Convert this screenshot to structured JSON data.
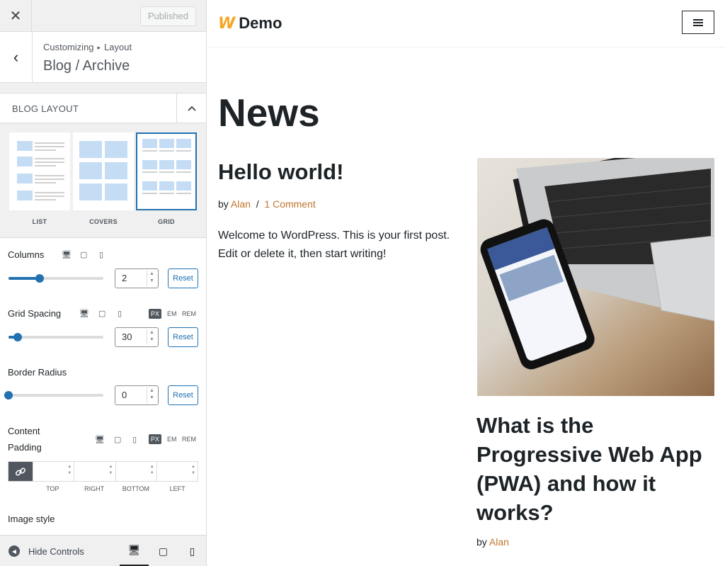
{
  "customizer": {
    "close_icon": "close-icon",
    "published_label": "Published",
    "back_icon": "chevron-left-icon",
    "breadcrumb": [
      "Customizing",
      "Layout"
    ],
    "section_title": "Blog / Archive",
    "panel_title": "BLOG LAYOUT",
    "layout_options": [
      {
        "label": "LIST",
        "selected": false
      },
      {
        "label": "COVERS",
        "selected": false
      },
      {
        "label": "GRID",
        "selected": true
      }
    ],
    "controls": {
      "columns": {
        "label": "Columns",
        "value": "2",
        "reset": "Reset",
        "level": 0.33
      },
      "grid_spacing": {
        "label": "Grid Spacing",
        "value": "30",
        "reset": "Reset",
        "level": 0.1,
        "units": [
          "PX",
          "EM",
          "REM"
        ],
        "active_unit": "PX"
      },
      "border_radius": {
        "label": "Border Radius",
        "value": "0",
        "reset": "Reset",
        "level": 0
      },
      "content_padding": {
        "label_line1": "Content",
        "label_line2": "Padding",
        "units": [
          "PX",
          "EM",
          "REM"
        ],
        "active_unit": "PX",
        "sides": [
          "TOP",
          "RIGHT",
          "BOTTOM",
          "LEFT"
        ]
      },
      "image_style": {
        "label": "Image style"
      }
    },
    "footer": {
      "hide_controls": "Hide Controls"
    }
  },
  "preview": {
    "site_name": "Demo",
    "page_title": "News",
    "posts": [
      {
        "title": "Hello world!",
        "by": "by",
        "author": "Alan",
        "sep": "/",
        "comments": "1 Comment",
        "excerpt": "Welcome to WordPress. This is your first post. Edit or delete it, then start writing!"
      },
      {
        "title": "What is the Progressive Web App (PWA) and how it works?",
        "by": "by",
        "author": "Alan"
      }
    ]
  },
  "colors": {
    "accent": "#2271b1",
    "link": "#c0762e",
    "logo": "#f5a623"
  }
}
